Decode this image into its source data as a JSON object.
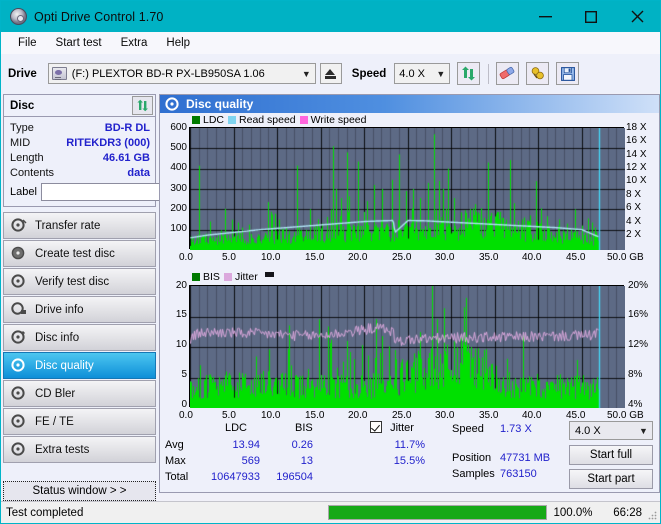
{
  "window": {
    "title": "Opti Drive Control 1.70",
    "icon": "disc-icon",
    "minimize": "—",
    "maximize": "□",
    "close": "✕",
    "accent": "#00b2c4"
  },
  "menu": {
    "items": [
      "File",
      "Start test",
      "Extra",
      "Help"
    ]
  },
  "toolbar": {
    "drive_label": "Drive",
    "drive_value": "(F:)  PLEXTOR BD-R  PX-LB950SA 1.06",
    "eject": "eject-icon",
    "speed_label": "Speed",
    "speed_value": "4.0 X",
    "refresh_icon": "refresh-icon",
    "eraser_icon": "eraser-icon",
    "tools_icon": "tools-icon",
    "save_icon": "save-icon"
  },
  "disc": {
    "title": "Disc",
    "refresh_icon": "refresh-icon",
    "rows": [
      {
        "key": "Type",
        "value": "BD-R DL"
      },
      {
        "key": "MID",
        "value": "RITEKDR3 (000)"
      },
      {
        "key": "Length",
        "value": "46.61 GB"
      },
      {
        "key": "Contents",
        "value": "data"
      }
    ],
    "label_key": "Label",
    "label_value": "",
    "label_placeholder": "",
    "label_button_icon": "disc-icon"
  },
  "nav": {
    "items": [
      {
        "label": "Transfer rate",
        "icon": "disc-scan-icon",
        "active": false
      },
      {
        "label": "Create test disc",
        "icon": "disc-burn-icon",
        "active": false
      },
      {
        "label": "Verify test disc",
        "icon": "disc-verify-icon",
        "active": false
      },
      {
        "label": "Drive info",
        "icon": "drive-info-icon",
        "active": false
      },
      {
        "label": "Disc info",
        "icon": "disc-info-icon",
        "active": false
      },
      {
        "label": "Disc quality",
        "icon": "disc-quality-icon",
        "active": true
      },
      {
        "label": "CD Bler",
        "icon": "disc-bler-icon",
        "active": false
      },
      {
        "label": "FE / TE",
        "icon": "disc-fete-icon",
        "active": false
      },
      {
        "label": "Extra tests",
        "icon": "disc-extra-icon",
        "active": false
      }
    ],
    "status_window": "Status window > >"
  },
  "panel": {
    "title": "Disc quality",
    "icon": "disc-quality-icon"
  },
  "chart_data": [
    {
      "id": "top",
      "type": "line",
      "title": "",
      "xlabel": "GB",
      "ylabel": "",
      "xlim": [
        0.0,
        50.0
      ],
      "xticks": [
        0.0,
        5.0,
        10.0,
        15.0,
        20.0,
        25.0,
        30.0,
        35.0,
        40.0,
        45.0,
        50.0
      ],
      "xticklabels": [
        "0.0",
        "5.0",
        "10.0",
        "15.0",
        "20.0",
        "25.0",
        "30.0",
        "35.0",
        "40.0",
        "45.0",
        "50.0 GB"
      ],
      "ylim": [
        0,
        600
      ],
      "yticks": [
        100,
        200,
        300,
        400,
        500,
        600
      ],
      "yticklabels": [
        "100",
        "200",
        "300",
        "400",
        "500",
        "600"
      ],
      "y2lim": [
        0,
        18
      ],
      "y2ticks": [
        2,
        4,
        6,
        8,
        10,
        12,
        14,
        16,
        18
      ],
      "y2ticklabels": [
        "2 X",
        "4 X",
        "6 X",
        "8 X",
        "10 X",
        "12 X",
        "14 X",
        "16 X",
        "18 X"
      ],
      "grid": true,
      "legend": [
        {
          "name": "LDC",
          "color": "#007a00"
        },
        {
          "name": "Read speed",
          "color": "#7fd4f0"
        },
        {
          "name": "Write speed",
          "color": "#ff66dd"
        }
      ],
      "series": [
        {
          "name": "LDC",
          "kind": "impulse",
          "color": "#00e000",
          "note": "dense green error spikes, baseline ~30-70 rising to ~120 after 25 GB, peaks to 569",
          "baseline": [
            40,
            42,
            45,
            44,
            48,
            46,
            50,
            52,
            48,
            46,
            44,
            47,
            50,
            52,
            55,
            54,
            50,
            48,
            52,
            56,
            58,
            54,
            50,
            52,
            56,
            60,
            58,
            56,
            60,
            62,
            58,
            56,
            60,
            64,
            66,
            62,
            58,
            60,
            64,
            68,
            70,
            66,
            62,
            64,
            68,
            72,
            74,
            70,
            66,
            68,
            72,
            76,
            78,
            74,
            70,
            72,
            76,
            80,
            82,
            78,
            74,
            76,
            80,
            84,
            86,
            82,
            78,
            80,
            84,
            88,
            90,
            86,
            82,
            84,
            88,
            92,
            94,
            90,
            86,
            88,
            92,
            96,
            98,
            94,
            90,
            92,
            96,
            100,
            102,
            98,
            94,
            96,
            100,
            104,
            106,
            102,
            98,
            100,
            120,
            135,
            140,
            138,
            132,
            128,
            125,
            122,
            120,
            118,
            116,
            114,
            112,
            110,
            108,
            106,
            104,
            102,
            100,
            98,
            96,
            94,
            92,
            90,
            88,
            86,
            84,
            82,
            80,
            78,
            76,
            74,
            72,
            70,
            68,
            66,
            64,
            62,
            60,
            58,
            56,
            54,
            52,
            50,
            48,
            46,
            44,
            42,
            40
          ],
          "peaks": [
            {
              "x": 1.0,
              "y": 415
            },
            {
              "x": 2.3,
              "y": 140
            },
            {
              "x": 6.0,
              "y": 110
            },
            {
              "x": 9.8,
              "y": 175
            },
            {
              "x": 10.2,
              "y": 150
            },
            {
              "x": 12.3,
              "y": 415
            },
            {
              "x": 13.8,
              "y": 200
            },
            {
              "x": 15.2,
              "y": 130
            },
            {
              "x": 16.4,
              "y": 510
            },
            {
              "x": 16.8,
              "y": 300
            },
            {
              "x": 17.4,
              "y": 255
            },
            {
              "x": 18.1,
              "y": 480
            },
            {
              "x": 19.3,
              "y": 435
            },
            {
              "x": 20.3,
              "y": 240
            },
            {
              "x": 21.2,
              "y": 320
            },
            {
              "x": 22.1,
              "y": 300
            },
            {
              "x": 23.2,
              "y": 345
            },
            {
              "x": 24.0,
              "y": 470
            },
            {
              "x": 24.8,
              "y": 290
            },
            {
              "x": 25.6,
              "y": 300
            },
            {
              "x": 26.4,
              "y": 255
            },
            {
              "x": 27.3,
              "y": 330
            },
            {
              "x": 28.1,
              "y": 569
            },
            {
              "x": 28.6,
              "y": 340
            },
            {
              "x": 29.1,
              "y": 300
            },
            {
              "x": 29.7,
              "y": 400
            },
            {
              "x": 30.4,
              "y": 200
            },
            {
              "x": 31.2,
              "y": 185
            },
            {
              "x": 32.5,
              "y": 205
            },
            {
              "x": 33.4,
              "y": 200
            },
            {
              "x": 34.2,
              "y": 430
            },
            {
              "x": 35.1,
              "y": 165
            },
            {
              "x": 36.3,
              "y": 150
            },
            {
              "x": 37.2,
              "y": 230
            },
            {
              "x": 38.4,
              "y": 160
            },
            {
              "x": 39.1,
              "y": 170
            },
            {
              "x": 40.3,
              "y": 205
            },
            {
              "x": 41.2,
              "y": 120
            },
            {
              "x": 42.4,
              "y": 150
            },
            {
              "x": 43.3,
              "y": 130
            },
            {
              "x": 44.2,
              "y": 200
            },
            {
              "x": 45.0,
              "y": 120
            },
            {
              "x": 45.8,
              "y": 155
            },
            {
              "x": 46.5,
              "y": 110
            }
          ]
        },
        {
          "name": "Read speed",
          "kind": "line",
          "color": "#aee4f5",
          "axis": "right",
          "x": [
            0.0,
            2.0,
            5.0,
            8.0,
            11.0,
            14.0,
            17.0,
            20.0,
            22.0,
            23.3,
            23.5,
            25.0,
            27.0,
            30.0,
            33.0,
            36.0,
            39.0,
            42.0,
            45.0,
            46.8
          ],
          "values_x": [
            1.8,
            2.2,
            2.6,
            3.0,
            3.3,
            3.6,
            3.9,
            4.2,
            4.3,
            4.35,
            2.6,
            4.35,
            4.3,
            4.1,
            3.9,
            3.7,
            3.5,
            3.3,
            3.0,
            2.0
          ]
        },
        {
          "name": "Write speed",
          "kind": "line",
          "color": "#ff66dd",
          "axis": "right",
          "x": [],
          "values_x": []
        },
        {
          "name": "end-marker",
          "kind": "vline",
          "color": "#44d8f8",
          "x": 47.0
        }
      ]
    },
    {
      "id": "bottom",
      "type": "line",
      "title": "",
      "xlabel": "GB",
      "ylabel": "",
      "xlim": [
        0.0,
        50.0
      ],
      "xticks": [
        0.0,
        5.0,
        10.0,
        15.0,
        20.0,
        25.0,
        30.0,
        35.0,
        40.0,
        45.0,
        50.0
      ],
      "xticklabels": [
        "0.0",
        "5.0",
        "10.0",
        "15.0",
        "20.0",
        "25.0",
        "30.0",
        "35.0",
        "40.0",
        "45.0",
        "50.0 GB"
      ],
      "ylim": [
        0,
        20
      ],
      "yticks": [
        0,
        5,
        10,
        15,
        20
      ],
      "yticklabels": [
        "0",
        "5",
        "10",
        "15",
        "20"
      ],
      "y2lim": [
        0,
        20
      ],
      "y2ticks": [
        4,
        8,
        12,
        16,
        20
      ],
      "y2ticklabels": [
        "4%",
        "8%",
        "12%",
        "16%",
        "20%"
      ],
      "grid": true,
      "legend": [
        {
          "name": "BIS",
          "color": "#007a00"
        },
        {
          "name": "Jitter",
          "color": "#dba8dd"
        }
      ],
      "series": [
        {
          "name": "BIS",
          "kind": "impulse",
          "color": "#00e000",
          "note": "green BIS spikes, baseline ~2-4, rising to ~5-10 after 16 GB, max 13",
          "baseline": [
            3.0,
            3.2,
            3.4,
            3.1,
            3.3,
            3.5,
            3.2,
            3.0,
            3.4,
            3.6,
            3.3,
            3.1,
            3.5,
            3.7,
            3.4,
            3.2,
            3.6,
            3.8,
            3.5,
            3.3,
            3.0,
            3.2,
            3.4,
            3.6,
            3.3,
            3.1,
            3.5,
            3.2,
            3.4,
            3.0,
            3.3,
            3.6,
            3.2,
            3.4,
            3.1,
            3.5,
            3.3,
            3.0,
            3.4,
            3.2,
            3.6,
            3.3,
            3.1,
            3.5,
            3.2,
            3.8,
            3.4,
            3.0,
            3.6,
            3.3,
            4.2,
            4.6,
            5.0,
            4.8,
            5.2,
            5.6,
            5.4,
            5.8,
            6.2,
            5.9,
            6.4,
            6.0,
            6.6,
            6.3,
            6.8,
            6.5,
            7.0,
            6.7,
            7.2,
            6.9,
            6.4,
            6.0,
            5.6,
            5.2,
            4.8,
            4.4,
            4.0,
            3.6,
            3.4,
            3.2,
            3.0,
            3.2,
            3.4,
            3.1,
            3.3,
            3.0,
            3.2,
            3.4,
            3.1,
            3.3,
            3.0,
            3.2,
            3.4,
            3.1,
            3.3,
            3.5,
            3.2,
            3.0,
            3.4,
            3.1
          ],
          "peaks": [
            {
              "x": 1.2,
              "y": 7.0
            },
            {
              "x": 4.4,
              "y": 5.3
            },
            {
              "x": 6.1,
              "y": 5.1
            },
            {
              "x": 8.2,
              "y": 5.6
            },
            {
              "x": 9.0,
              "y": 6.0
            },
            {
              "x": 10.6,
              "y": 5.2
            },
            {
              "x": 12.2,
              "y": 5.4
            },
            {
              "x": 13.6,
              "y": 6.4
            },
            {
              "x": 15.0,
              "y": 5.4
            },
            {
              "x": 16.2,
              "y": 11.2
            },
            {
              "x": 16.9,
              "y": 6.6
            },
            {
              "x": 17.6,
              "y": 7.6
            },
            {
              "x": 18.1,
              "y": 11.0
            },
            {
              "x": 18.9,
              "y": 8.0
            },
            {
              "x": 19.8,
              "y": 10.3
            },
            {
              "x": 20.5,
              "y": 8.6
            },
            {
              "x": 21.3,
              "y": 8.2
            },
            {
              "x": 22.1,
              "y": 9.0
            },
            {
              "x": 22.9,
              "y": 10.1
            },
            {
              "x": 23.6,
              "y": 9.5
            },
            {
              "x": 24.4,
              "y": 8.0
            },
            {
              "x": 25.5,
              "y": 6.5
            },
            {
              "x": 26.6,
              "y": 7.0
            },
            {
              "x": 27.3,
              "y": 8.2
            },
            {
              "x": 28.2,
              "y": 8.4
            },
            {
              "x": 29.0,
              "y": 7.3
            },
            {
              "x": 29.8,
              "y": 6.2
            },
            {
              "x": 31.0,
              "y": 6.0
            },
            {
              "x": 33.6,
              "y": 8.3
            },
            {
              "x": 35.2,
              "y": 4.6
            },
            {
              "x": 37.0,
              "y": 4.4
            },
            {
              "x": 39.0,
              "y": 4.6
            },
            {
              "x": 41.0,
              "y": 4.3
            },
            {
              "x": 43.0,
              "y": 4.2
            },
            {
              "x": 44.4,
              "y": 5.3
            },
            {
              "x": 46.0,
              "y": 4.0
            }
          ]
        },
        {
          "name": "Jitter",
          "kind": "band",
          "color": "#dba8dd",
          "axis": "right",
          "note": "noisy pink jitter band, ~11-13%, dips to ~10.5% near 23.5 GB",
          "x": [
            0.0,
            1.0,
            3.0,
            5.0,
            7.0,
            9.0,
            11.0,
            13.0,
            15.0,
            17.0,
            19.0,
            21.0,
            22.5,
            23.3,
            23.6,
            25.0,
            28.0,
            31.0,
            34.0,
            37.0,
            40.0,
            43.0,
            46.0,
            46.9
          ],
          "mean": [
            11.3,
            12.3,
            12.4,
            12.3,
            12.2,
            12.1,
            12.0,
            11.8,
            11.9,
            12.2,
            12.6,
            13.1,
            13.0,
            12.4,
            10.8,
            11.2,
            11.4,
            11.5,
            11.6,
            11.6,
            11.7,
            11.8,
            11.9,
            12.6
          ],
          "amplitude": 0.9
        },
        {
          "name": "end-marker",
          "kind": "vline",
          "color": "#44d8f8",
          "x": 47.0
        }
      ]
    }
  ],
  "stats": {
    "columns": [
      "LDC",
      "BIS"
    ],
    "jitter_label": "Jitter",
    "jitter_checked": true,
    "rows": [
      {
        "name": "Avg",
        "ldc": "13.94",
        "bis": "0.26",
        "jitter": "11.7%"
      },
      {
        "name": "Max",
        "ldc": "569",
        "bis": "13",
        "jitter": "15.5%"
      },
      {
        "name": "Total",
        "ldc": "10647933",
        "bis": "196504",
        "jitter": ""
      }
    ]
  },
  "readout": {
    "speed_label": "Speed",
    "speed_value": "1.73 X",
    "position_label": "Position",
    "position_value": "47731 MB",
    "samples_label": "Samples",
    "samples_value": "763150",
    "speed_select": "4.0 X",
    "start_full": "Start full",
    "start_part": "Start part"
  },
  "statusbar": {
    "message": "Test completed",
    "progress_pct": 100.0,
    "progress_text": "100.0%",
    "elapsed": "66:28"
  }
}
